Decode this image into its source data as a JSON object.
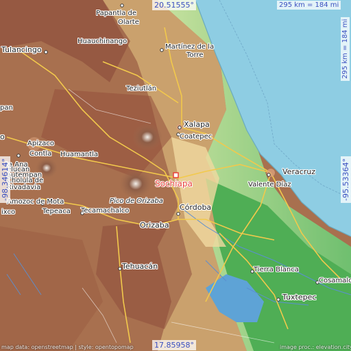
{
  "coords": {
    "top": "20.51555°",
    "bottom": "17.85958°",
    "left": "-98.34614°",
    "right": "-95.53364°"
  },
  "scale": {
    "horizontal": "295 km = 184 mi",
    "vertical": "295 km = 184 mi"
  },
  "highlight": {
    "name": "Sochiapa",
    "color": "#e8413a"
  },
  "places": [
    {
      "id": "papantla",
      "text": "Papantla de"
    },
    {
      "id": "olarte",
      "text": "Olarte"
    },
    {
      "id": "huauchinango",
      "text": "Huauchinango"
    },
    {
      "id": "tulancingo",
      "text": "Tulancingo"
    },
    {
      "id": "martinez1",
      "text": "Martínez de la"
    },
    {
      "id": "martinez2",
      "text": "Torre"
    },
    {
      "id": "teziutlan",
      "text": "Teziutlán"
    },
    {
      "id": "xalapa",
      "text": "Xalapa"
    },
    {
      "id": "coatepec",
      "text": "Coatepec"
    },
    {
      "id": "apizaco",
      "text": "Apizaco"
    },
    {
      "id": "contla",
      "text": "Contla"
    },
    {
      "id": "huamantla",
      "text": "Huamantla"
    },
    {
      "id": "anaana",
      "text": "ta Ana"
    },
    {
      "id": "autempan",
      "text": "autempan"
    },
    {
      "id": "cholula",
      "text": "Cholula de"
    },
    {
      "id": "rivadavia",
      "text": "Rivadavia"
    },
    {
      "id": "amozoc",
      "text": "Amozoc de Mota"
    },
    {
      "id": "ixco",
      "text": "ixco"
    },
    {
      "id": "tepeaca",
      "text": "Tepeaca"
    },
    {
      "id": "tecamachalco",
      "text": "Tecamachalco"
    },
    {
      "id": "pico",
      "text": "Pico de Orizaba"
    },
    {
      "id": "orizaba",
      "text": "Orizaba"
    },
    {
      "id": "cordoba",
      "text": "Córdoba"
    },
    {
      "id": "veracruz",
      "text": "Veracruz"
    },
    {
      "id": "valente",
      "text": "Valente Díaz"
    },
    {
      "id": "tehuacan",
      "text": "Tehuacán"
    },
    {
      "id": "tierrablanca",
      "text": "Tierra Blanca"
    },
    {
      "id": "cosamalo",
      "text": "Cosamalo"
    },
    {
      "id": "tuxtepec",
      "text": "Tuxtepec"
    },
    {
      "id": "o_left",
      "text": "o"
    },
    {
      "id": "pan",
      "text": "pan"
    },
    {
      "id": "elucan",
      "text": "elucan"
    }
  ],
  "credits": {
    "left": "map data: openstreetmap | style: opentopomap",
    "right": "image proc.: elevation.city"
  },
  "colors": {
    "sea": "#8ecde3",
    "coord_text": "#3a4fc0",
    "roads": "#f2c94c",
    "water_lines": "#5b8fd1"
  }
}
